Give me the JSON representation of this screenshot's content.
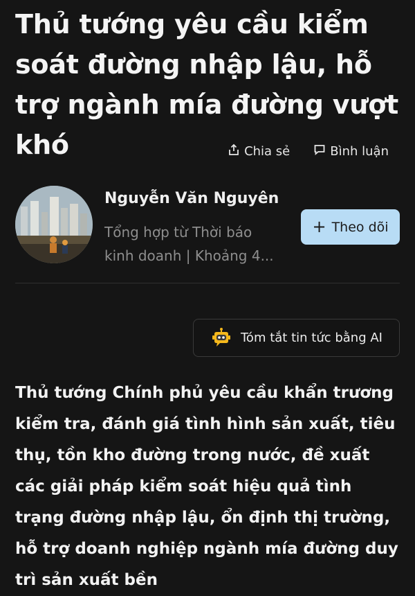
{
  "article": {
    "headline": "Thủ tướng yêu cầu kiểm soát đường nhập lậu, hỗ trợ ngành mía đường vượt khó",
    "body": "Thủ tướng Chính phủ yêu cầu khẩn trương kiểm tra, đánh giá tình hình sản xuất, tiêu thụ, tồn kho đường trong nước, đề xuất các giải pháp kiểm soát hiệu quả tình trạng đường nhập lậu, ổn định thị trường, hỗ trợ doanh nghiệp ngành mía đường duy trì sản xuất bền"
  },
  "actions": {
    "share_label": "Chia sẻ",
    "comment_label": "Bình luận"
  },
  "author": {
    "name": "Nguyễn Văn Nguyên",
    "meta": "Tổng hợp từ Thời báo kinh doanh | Khoảng 4...",
    "follow_label": "Theo dõi"
  },
  "ai_summary": {
    "label": "Tóm tắt tin tức bằng AI"
  },
  "icons": {
    "share": "share-icon",
    "comment": "comment-icon",
    "plus": "plus-icon",
    "ai_bot": "robot-icon"
  },
  "colors": {
    "background": "#151515",
    "follow_button": "#b8dcf5",
    "bot_icon": "#f5b81c"
  }
}
